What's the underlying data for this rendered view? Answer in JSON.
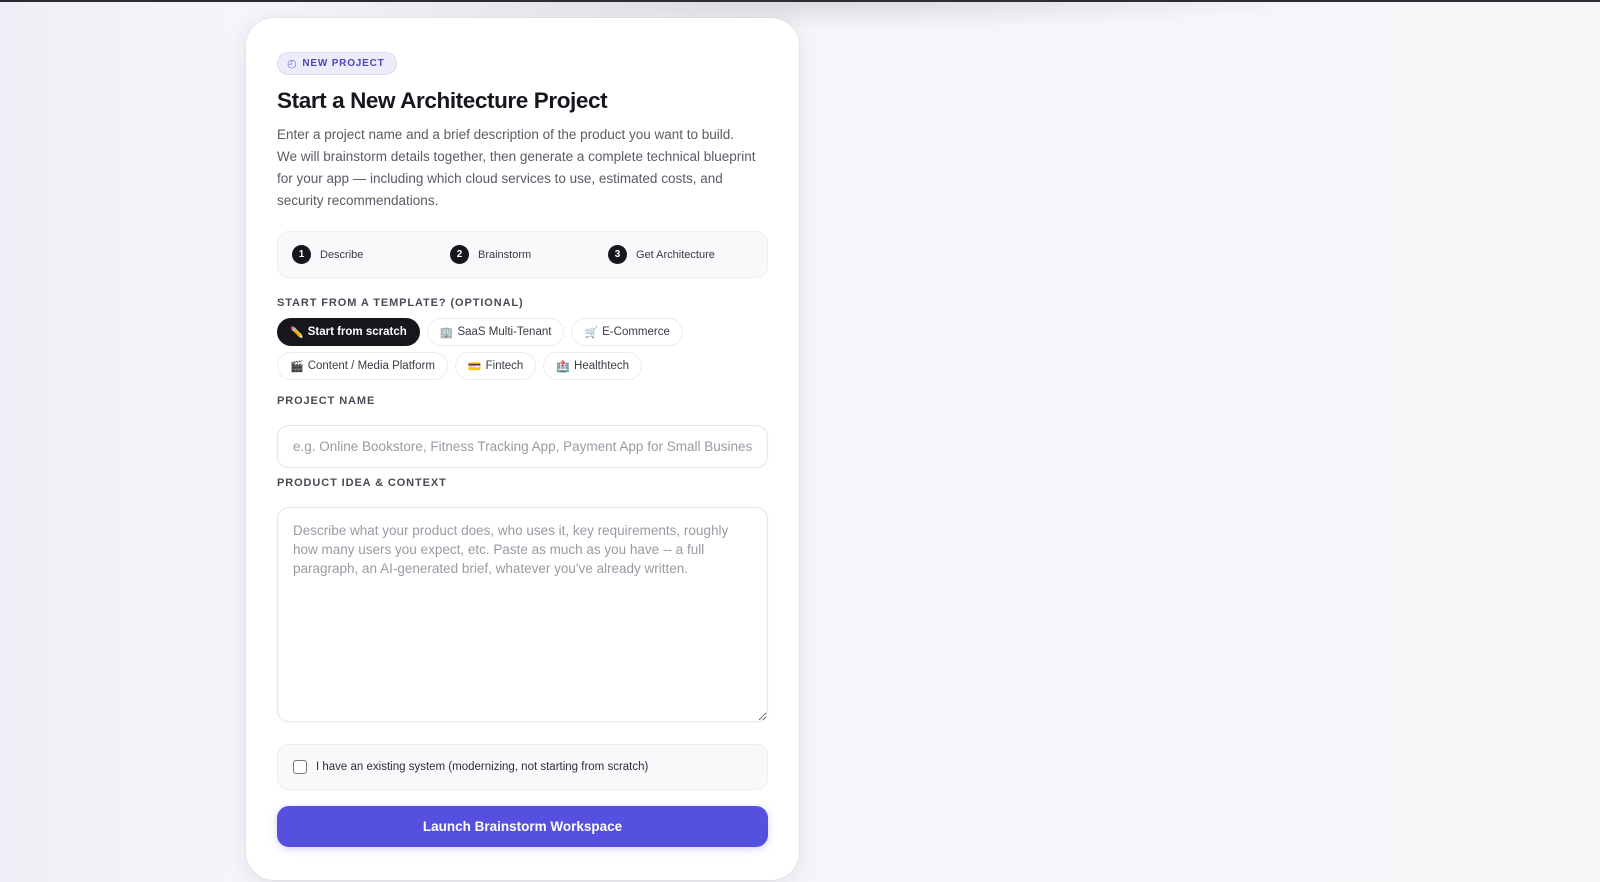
{
  "badge": {
    "icon": "compass-icon",
    "label": "NEW PROJECT"
  },
  "title": "Start a New Architecture Project",
  "description": "Enter a project name and a brief description of the product you want to build. We will brainstorm details together, then generate a complete technical blueprint for your app — including which cloud services to use, estimated costs, and security recommendations.",
  "steps": [
    {
      "num": "1",
      "label": "Describe"
    },
    {
      "num": "2",
      "label": "Brainstorm"
    },
    {
      "num": "3",
      "label": "Get Architecture"
    }
  ],
  "templates": {
    "label": "START FROM A TEMPLATE? (OPTIONAL)",
    "items": [
      {
        "icon": "✏️",
        "label": "Start from scratch",
        "active": true
      },
      {
        "icon": "🏢",
        "label": "SaaS Multi-Tenant"
      },
      {
        "icon": "🛒",
        "label": "E-Commerce"
      },
      {
        "icon": "🎬",
        "label": "Content / Media Platform"
      },
      {
        "icon": "💳",
        "label": "Fintech"
      },
      {
        "icon": "🏥",
        "label": "Healthtech"
      }
    ]
  },
  "project_name": {
    "label": "PROJECT NAME",
    "value": "",
    "placeholder": "e.g. Online Bookstore, Fitness Tracking App, Payment App for Small Businesses"
  },
  "product_idea": {
    "label": "PRODUCT IDEA & CONTEXT",
    "value": "",
    "placeholder": "Describe what your product does, who uses it, key requirements, roughly how many users you expect, etc. Paste as much as you have -- a full paragraph, an AI-generated brief, whatever you've already written."
  },
  "existing_system": {
    "checked": false,
    "label": "I have an existing system (modernizing, not starting from scratch)"
  },
  "launch_button": "Launch Brainstorm Workspace",
  "colors": {
    "accent": "#5550e0",
    "dark": "#16161c",
    "badge_bg": "#ececfb"
  }
}
